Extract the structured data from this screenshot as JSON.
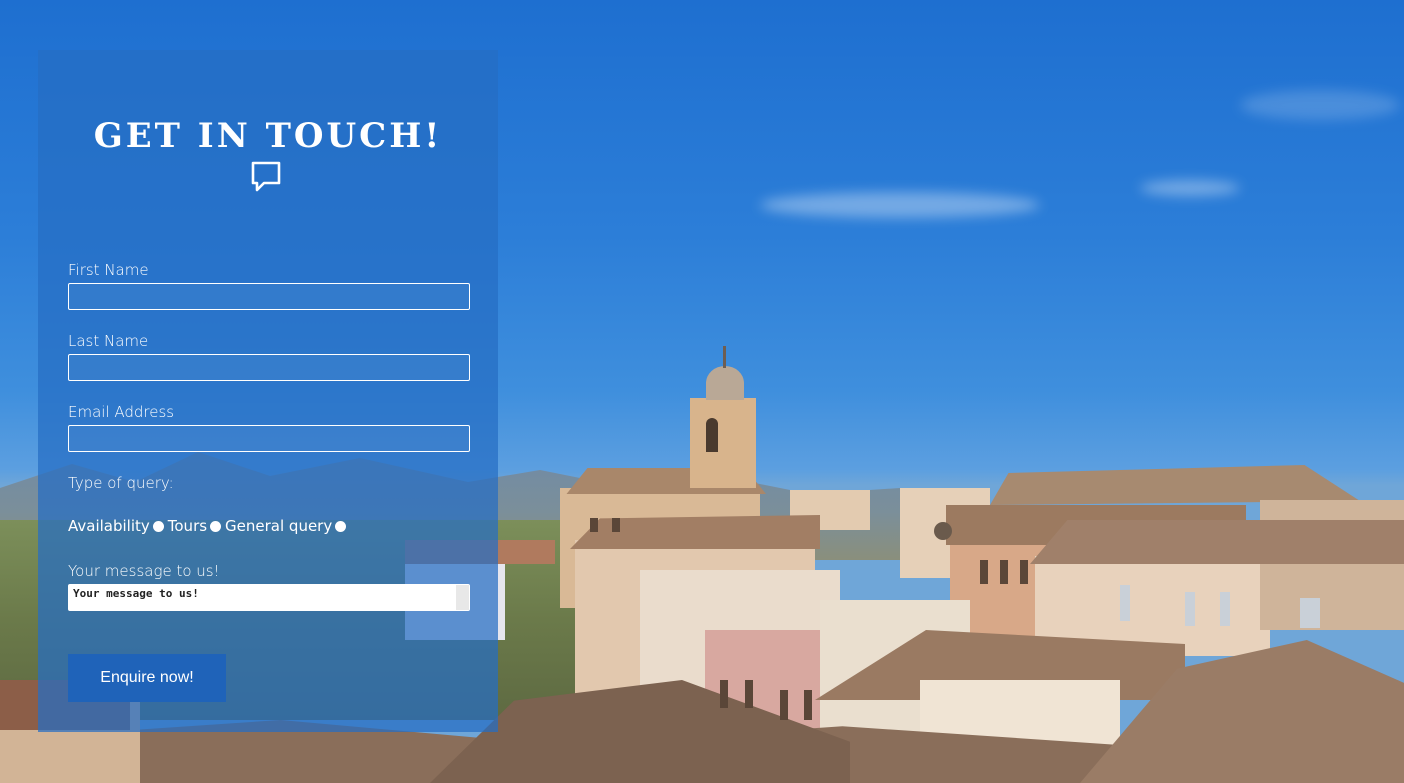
{
  "contact_form": {
    "title": "GET IN TOUCH!",
    "title_icon": "chat-bubble-icon",
    "fields": [
      {
        "label": "First Name",
        "value": ""
      },
      {
        "label": "Last Name",
        "value": ""
      },
      {
        "label": "Email Address",
        "value": ""
      }
    ],
    "query_type_label": "Type of query:",
    "query_options": [
      "Availability",
      "Tours",
      "General query"
    ],
    "message_label": "Your message to us!",
    "message_placeholder": "Your message to us!",
    "submit_label": "Enquire now!"
  },
  "colors": {
    "panel_bg": "#266ec4",
    "button_bg": "#1f63b9",
    "text": "#ffffff"
  }
}
